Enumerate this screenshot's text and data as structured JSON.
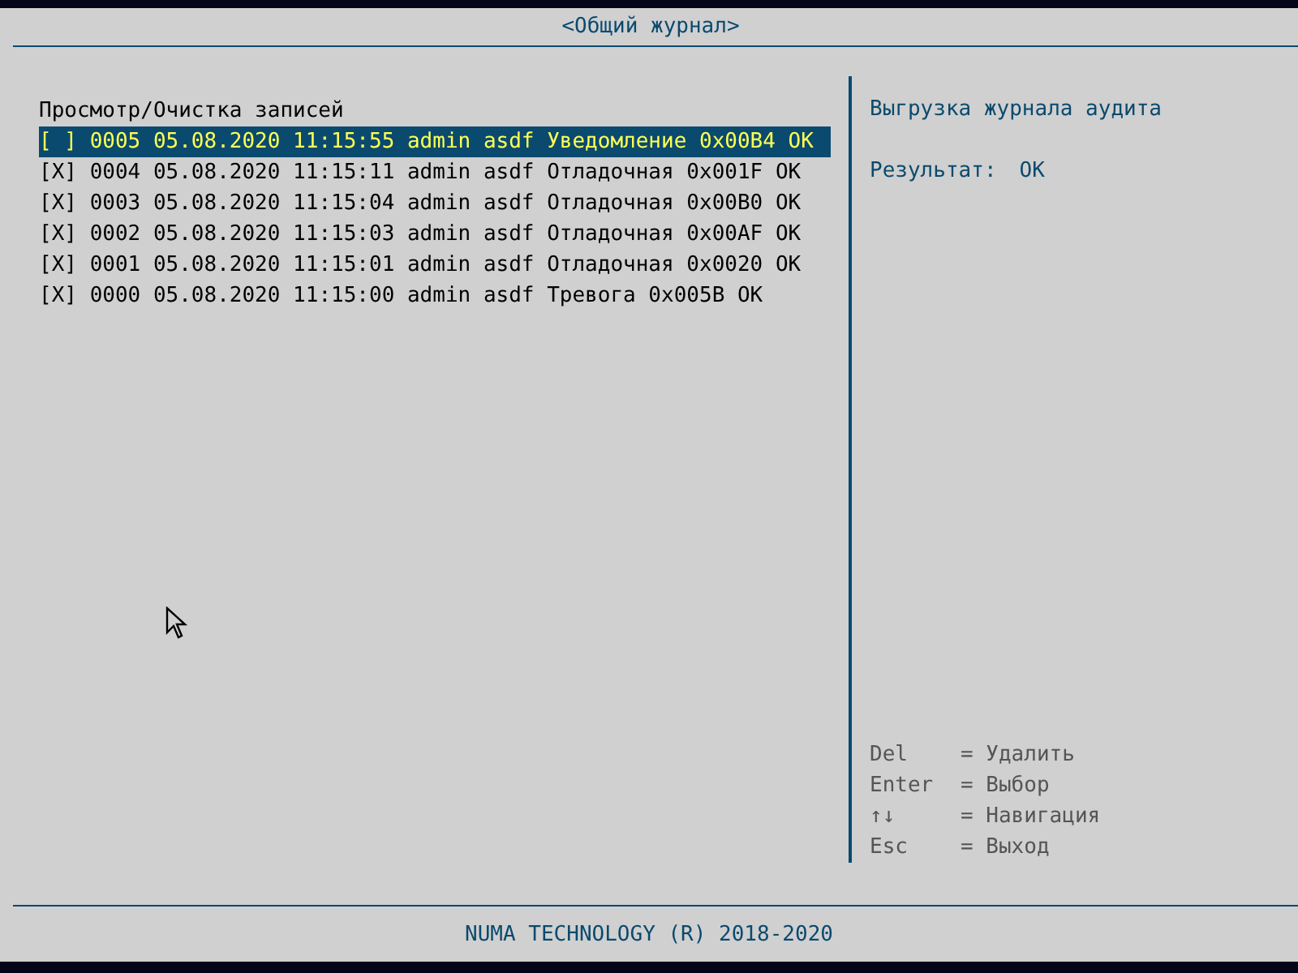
{
  "window": {
    "title": "<Общий журнал>"
  },
  "list": {
    "heading": "Просмотр/Очистка записей",
    "rows": [
      {
        "checkbox": "[ ]",
        "text": "0005 05.08.2020 11:15:55 admin asdf Уведомление 0x00B4 OK",
        "selected": true
      },
      {
        "checkbox": "[X]",
        "text": "0004 05.08.2020 11:15:11 admin asdf Отладочная 0x001F OK",
        "selected": false
      },
      {
        "checkbox": "[X]",
        "text": "0003 05.08.2020 11:15:04 admin asdf Отладочная 0x00B0 OK",
        "selected": false
      },
      {
        "checkbox": "[X]",
        "text": "0002 05.08.2020 11:15:03 admin asdf Отладочная 0x00AF OK",
        "selected": false
      },
      {
        "checkbox": "[X]",
        "text": "0001 05.08.2020 11:15:01 admin asdf Отладочная 0x0020 OK",
        "selected": false
      },
      {
        "checkbox": "[X]",
        "text": "0000 05.08.2020 11:15:00 admin asdf Тревога 0x005B OK",
        "selected": false
      }
    ]
  },
  "help_panel": {
    "title": "Выгрузка журнала аудита",
    "result_label": "Результат:",
    "result_value": "OK",
    "keys": [
      {
        "key": "Del",
        "action": "= Удалить"
      },
      {
        "key": "Enter",
        "action": "= Выбор"
      },
      {
        "key": "↑↓",
        "action": "= Навигация"
      },
      {
        "key": "Esc",
        "action": "= Выход"
      }
    ]
  },
  "footer": {
    "text": "NUMA TECHNOLOGY (R) 2018-2020"
  }
}
